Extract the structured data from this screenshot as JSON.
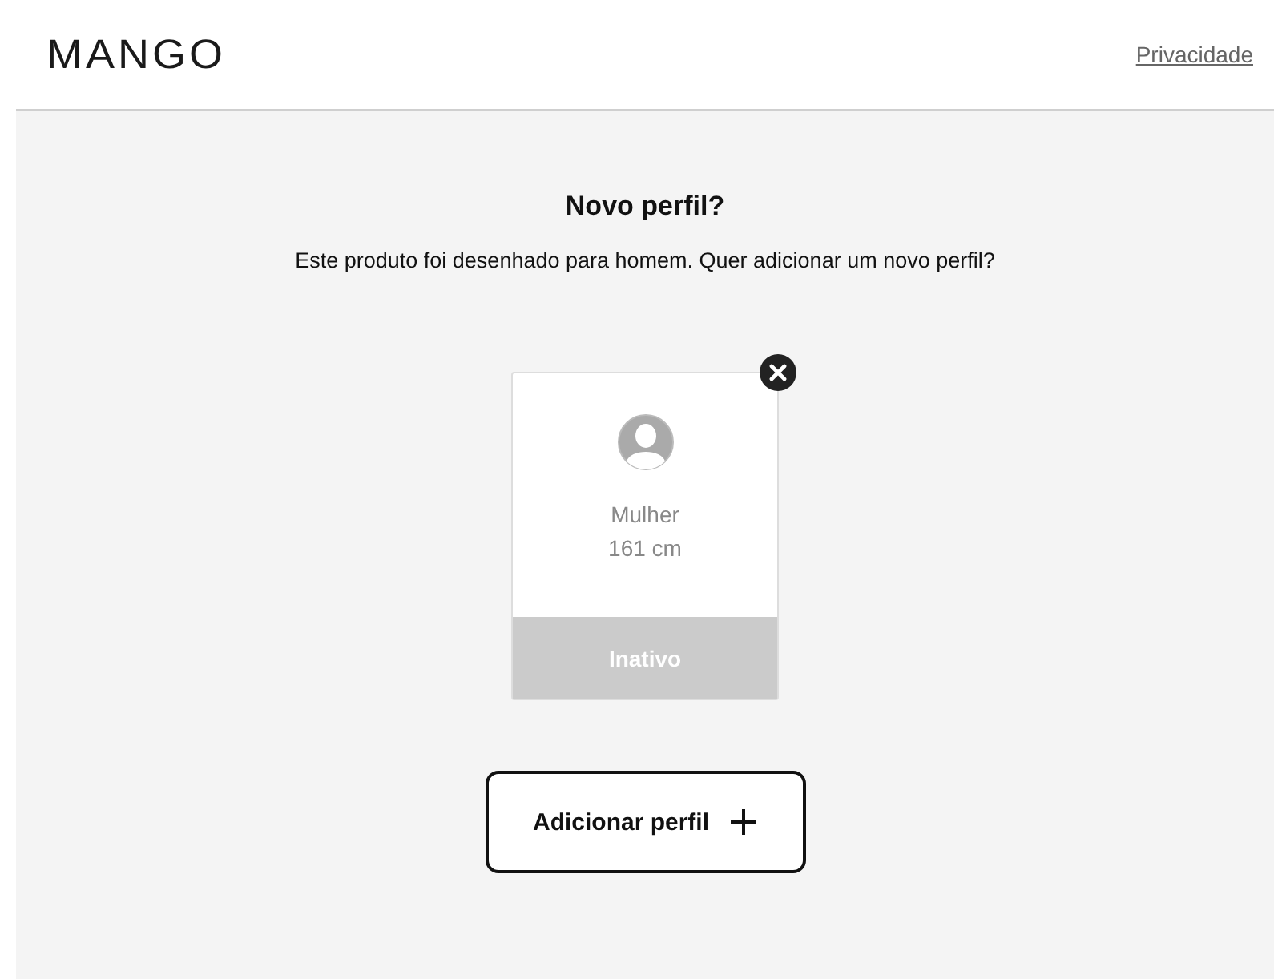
{
  "header": {
    "logo": "MANGO",
    "privacy_link": "Privacidade"
  },
  "dialog": {
    "title": "Novo perfil?",
    "message": "Este produto foi desenhado para homem. Quer adicionar um novo perfil?",
    "profiles": [
      {
        "name": "Mulher",
        "height": "161 cm",
        "status": "Inativo",
        "active": false
      }
    ],
    "add_button": {
      "label": "Adicionar perfil"
    }
  }
}
